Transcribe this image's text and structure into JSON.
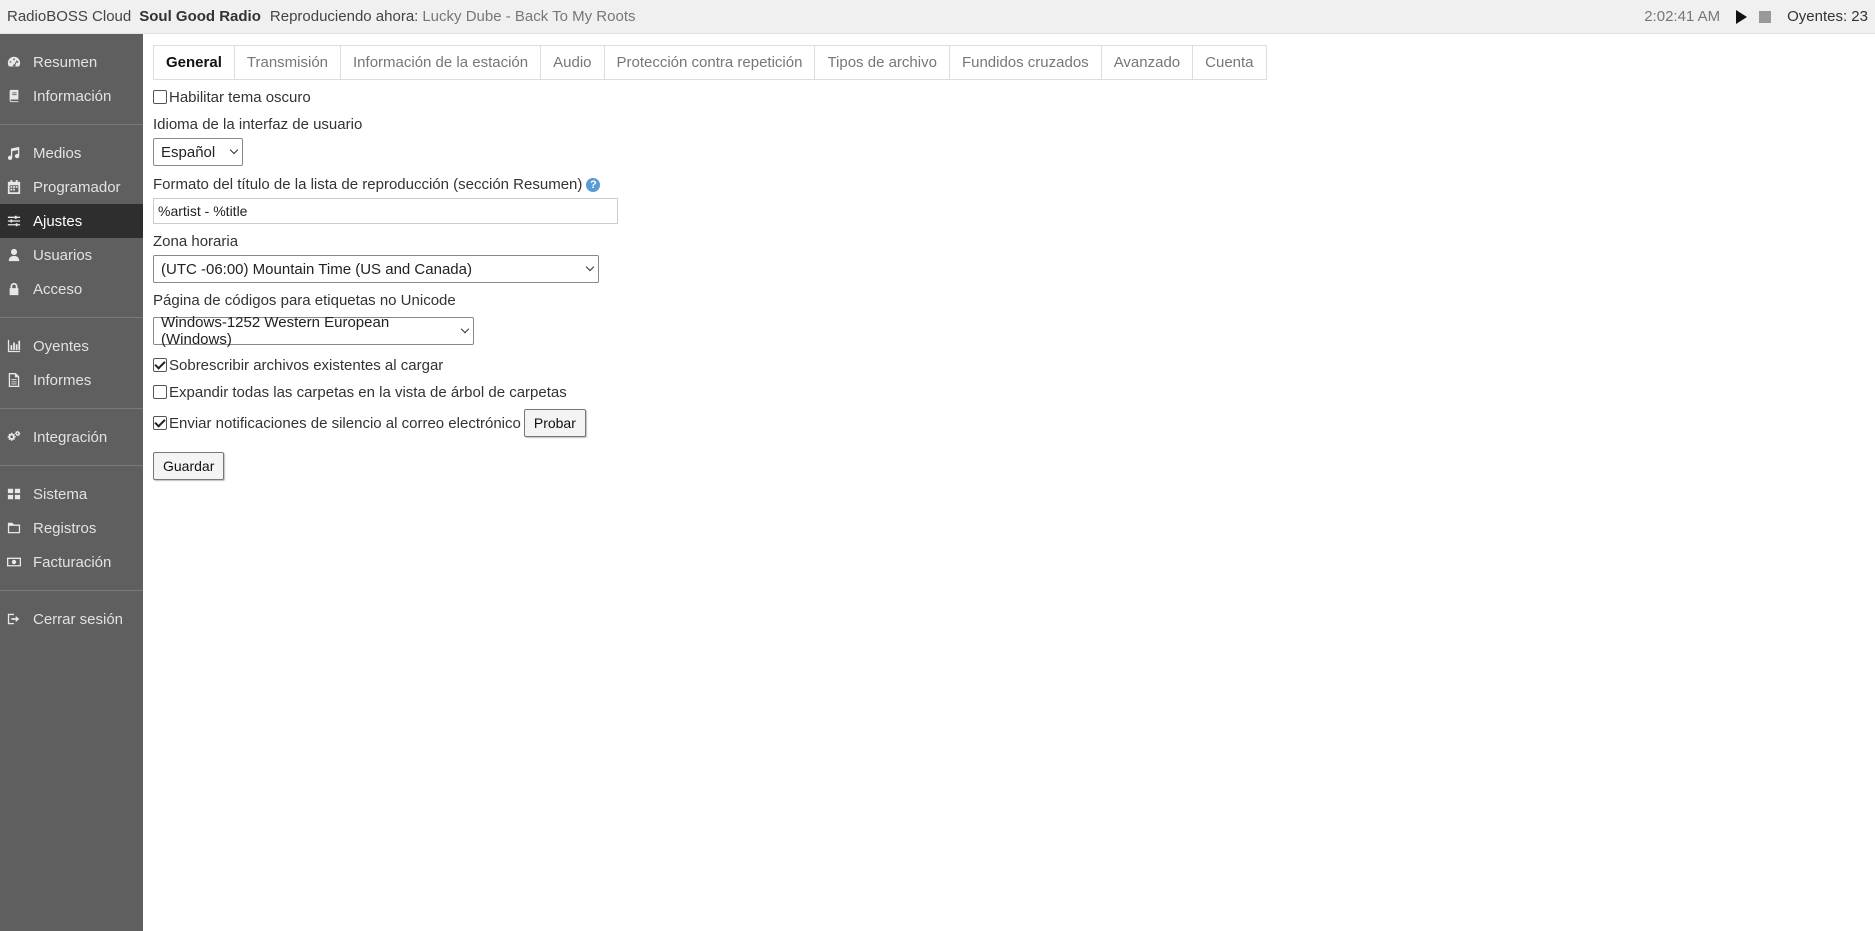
{
  "topbar": {
    "app_name": "RadioBOSS Cloud",
    "station_name": "Soul Good Radio",
    "now_playing_label": "Reproduciendo ahora:",
    "now_playing_track": "Lucky Dube - Back To My Roots",
    "clock": "2:02:41 AM",
    "listeners": "Oyentes: 23"
  },
  "sidebar": {
    "groups": [
      [
        {
          "label": "Resumen",
          "icon": "gauge-icon"
        },
        {
          "label": "Información",
          "icon": "book-icon"
        }
      ],
      [
        {
          "label": "Medios",
          "icon": "music-icon"
        },
        {
          "label": "Programador",
          "icon": "calendar-icon"
        },
        {
          "label": "Ajustes",
          "icon": "sliders-icon",
          "active": true
        },
        {
          "label": "Usuarios",
          "icon": "user-icon"
        },
        {
          "label": "Acceso",
          "icon": "lock-icon"
        }
      ],
      [
        {
          "label": "Oyentes",
          "icon": "bar-chart-icon"
        },
        {
          "label": "Informes",
          "icon": "document-icon"
        }
      ],
      [
        {
          "label": "Integración",
          "icon": "gears-icon"
        }
      ],
      [
        {
          "label": "Sistema",
          "icon": "grid-icon"
        },
        {
          "label": "Registros",
          "icon": "folder-icon"
        },
        {
          "label": "Facturación",
          "icon": "money-icon"
        }
      ],
      [
        {
          "label": "Cerrar sesión",
          "icon": "sign-out-icon"
        }
      ]
    ]
  },
  "tabs": [
    {
      "label": "General",
      "active": true
    },
    {
      "label": "Transmisión"
    },
    {
      "label": "Información de la estación"
    },
    {
      "label": "Audio"
    },
    {
      "label": "Protección contra repetición"
    },
    {
      "label": "Tipos de archivo"
    },
    {
      "label": "Fundidos cruzados"
    },
    {
      "label": "Avanzado"
    },
    {
      "label": "Cuenta"
    }
  ],
  "form": {
    "dark_theme_label": "Habilitar tema oscuro",
    "dark_theme_checked": false,
    "language_label": "Idioma de la interfaz de usuario",
    "language_value": "Español",
    "title_format_label": "Formato del título de la lista de reproducción (sección Resumen)",
    "title_format_value": "%artist - %title",
    "timezone_label": "Zona horaria",
    "timezone_value": "(UTC -06:00) Mountain Time (US and Canada)",
    "codepage_label": "Página de códigos para etiquetas no Unicode",
    "codepage_value": "Windows-1252 Western European (Windows)",
    "overwrite_label": "Sobrescribir archivos existentes al cargar",
    "overwrite_checked": true,
    "expand_label": "Expandir todas las carpetas en la vista de árbol de carpetas",
    "expand_checked": false,
    "silence_label": "Enviar notificaciones de silencio al correo electrónico",
    "silence_checked": true,
    "test_button": "Probar",
    "save_button": "Guardar"
  }
}
